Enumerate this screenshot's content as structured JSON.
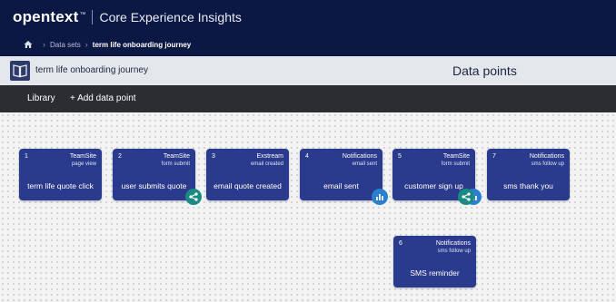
{
  "brand": {
    "logo": "opentext",
    "tm": "™",
    "product": "Core Experience Insights"
  },
  "breadcrumb": {
    "home": "home-icon",
    "items": [
      "Data sets",
      "term life onboarding journey"
    ]
  },
  "subheader": {
    "journey_title": "term life onboarding journey",
    "panel_title": "Data points"
  },
  "toolbar": {
    "library": "Library",
    "add": "+ Add data point"
  },
  "cards": [
    {
      "num": "1",
      "source": "TeamSite",
      "event": "page view",
      "name": "term life quote click"
    },
    {
      "num": "2",
      "source": "TeamSite",
      "event": "form submit",
      "name": "user submits quote"
    },
    {
      "num": "3",
      "source": "Exstream",
      "event": "email created",
      "name": "email quote created"
    },
    {
      "num": "4",
      "source": "Notifications",
      "event": "email sent",
      "name": "email sent"
    },
    {
      "num": "5",
      "source": "TeamSite",
      "event": "form submit",
      "name": "customer sign up"
    },
    {
      "num": "7",
      "source": "Notifications",
      "event": "sms follow up",
      "name": "sms thank you"
    },
    {
      "num": "6",
      "source": "Notifications",
      "event": "sms follow up",
      "name": "SMS reminder"
    }
  ],
  "colors": {
    "topbar": "#0c1844",
    "card": "#2a3a8c",
    "badge_teal": "#1a8a84",
    "badge_blue": "#2a7fd0"
  }
}
